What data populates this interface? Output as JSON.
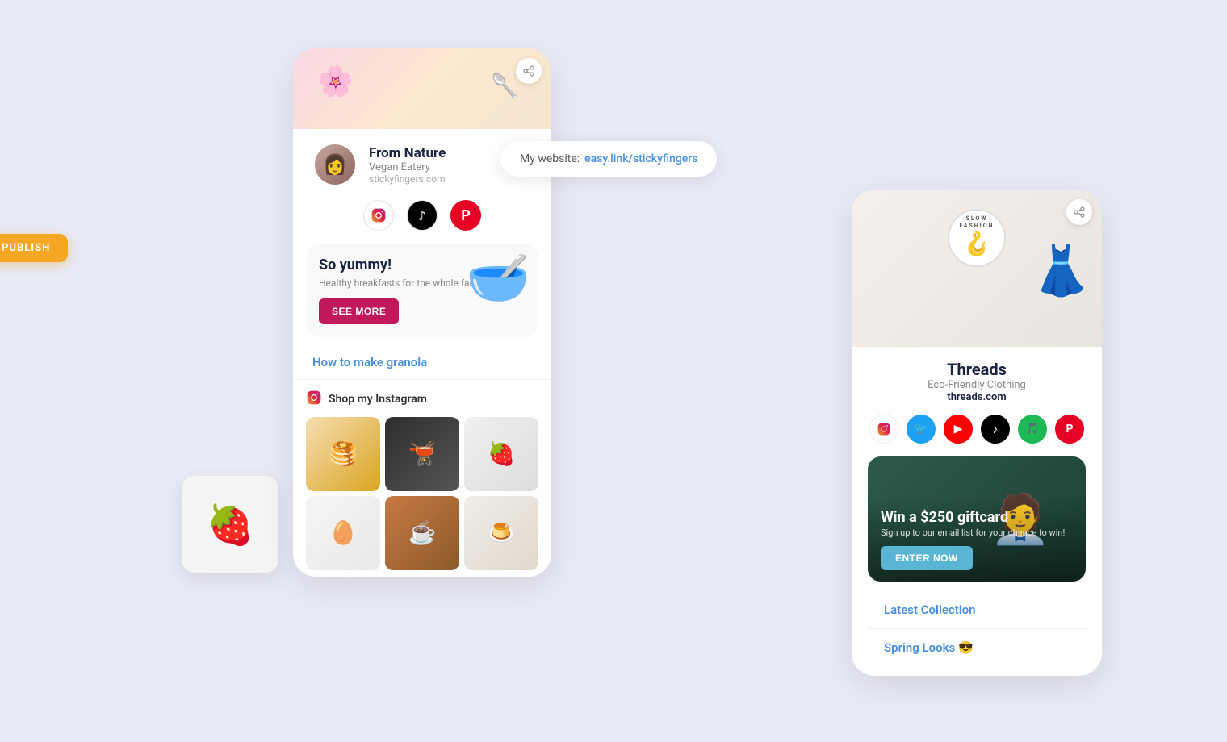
{
  "background_color": "#e8eaf6",
  "left_card": {
    "profile": {
      "name": "From Nature",
      "subtitle": "Vegan Eatery",
      "website": "stickyfingers.com"
    },
    "website_label": "My website:",
    "website_url": "easy.link/stickyfingers",
    "publish_label": "PUBLISH",
    "share_icon": "↗",
    "food_banner": {
      "title": "So yummy!",
      "subtitle": "Healthy breakfasts for the whole family",
      "button_label": "SEE MORE"
    },
    "granola_link": "How to make granola",
    "instagram_section": {
      "title": "Shop my Instagram",
      "icon": "📷"
    },
    "social_icons": [
      "📷",
      "♪",
      "📌"
    ]
  },
  "right_card": {
    "logo_text": "SLOW FASHION",
    "name": "Threads",
    "subtitle": "Eco-Friendly Clothing",
    "url": "threads.com",
    "share_icon": "↗",
    "social_icons": [
      "📷",
      "🐦",
      "▶",
      "♪",
      "🎵",
      "📌"
    ],
    "giftcard": {
      "title": "Win a $250 giftcard",
      "subtitle": "Sign up to our email list for your chance to win!",
      "button_label": "ENTER NOW"
    },
    "latest_collection": "Latest Collection",
    "spring_looks": "Spring Looks 😎"
  },
  "floating_photo": {
    "emoji": "🍓"
  }
}
